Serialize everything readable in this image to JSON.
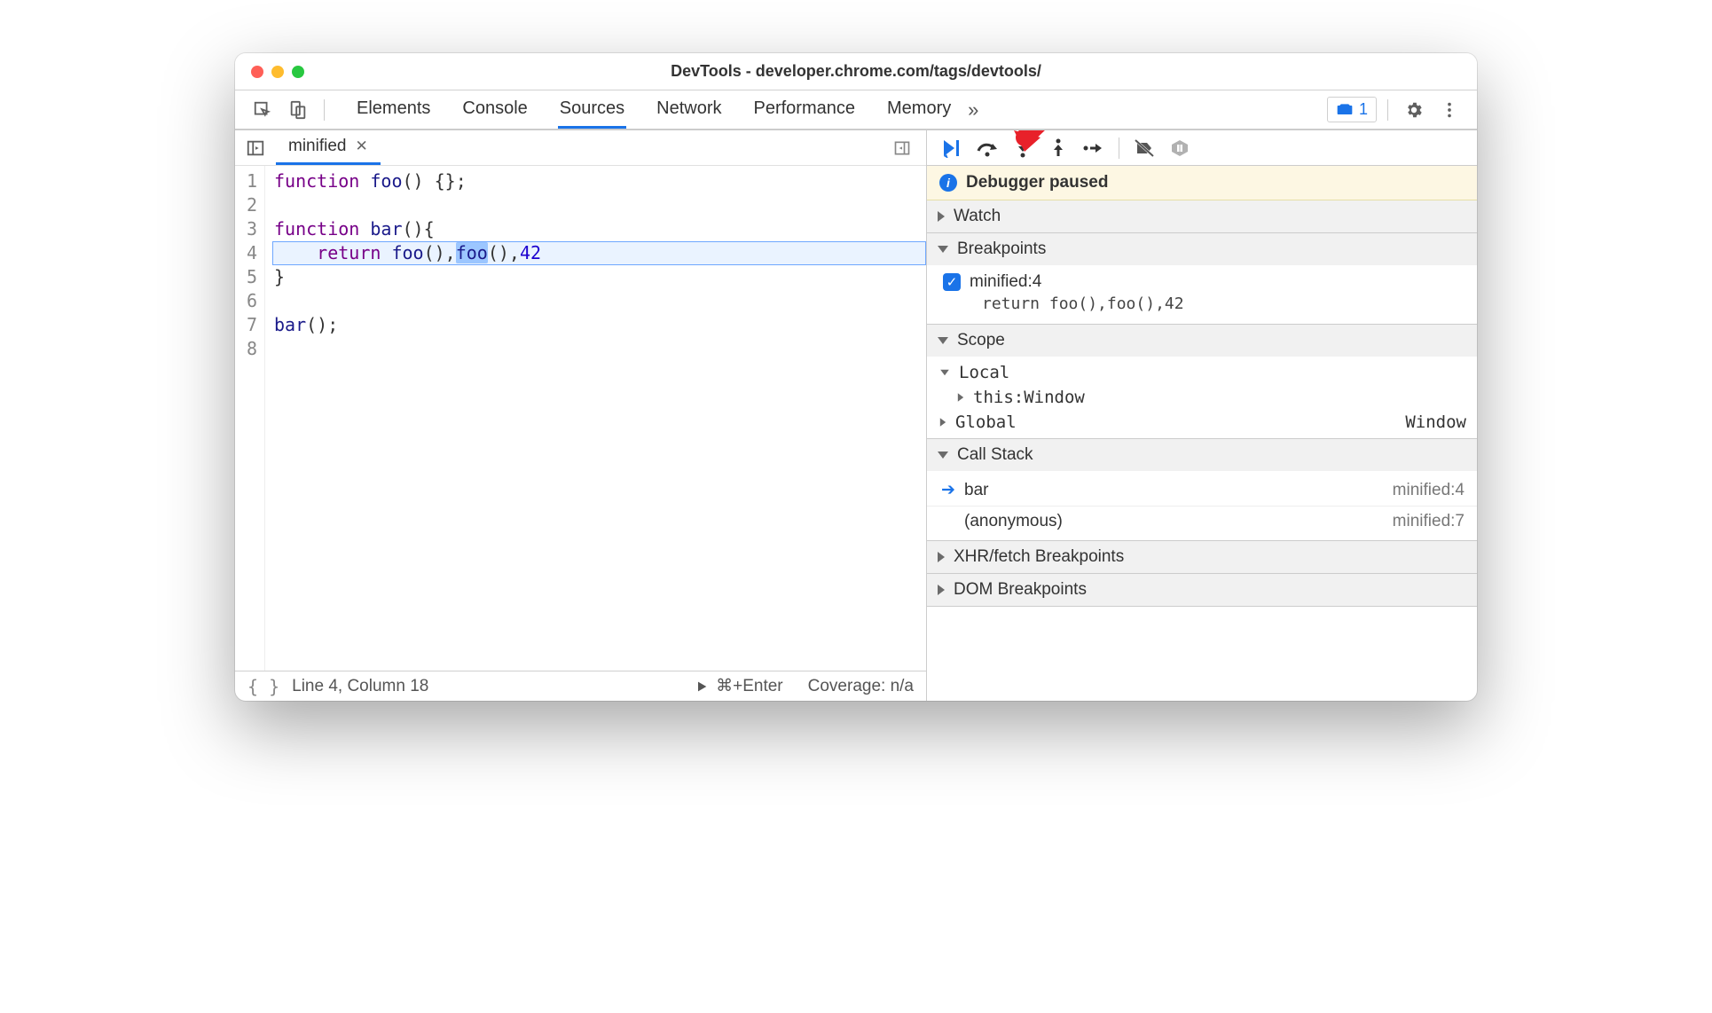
{
  "window": {
    "title": "DevTools - developer.chrome.com/tags/devtools/"
  },
  "tabs": {
    "items": [
      "Elements",
      "Console",
      "Sources",
      "Network",
      "Performance",
      "Memory"
    ],
    "active_index": 2,
    "more_glyph": "»"
  },
  "issues": {
    "count": "1"
  },
  "file_tab": {
    "name": "minified"
  },
  "code": {
    "lines": [
      {
        "n": "1",
        "html": "<span class='kw'>function</span> <span class='fn'>foo</span>() {};"
      },
      {
        "n": "2",
        "html": ""
      },
      {
        "n": "3",
        "html": "<span class='kw'>function</span> <span class='fn'>bar</span>(){"
      },
      {
        "n": "4",
        "hl": true,
        "html": "    <span class='kw'>return</span> <span class='fn'>foo</span>(),<span class='sel'><span class='fn'>foo</span></span>(),<span class='num'>42</span>"
      },
      {
        "n": "5",
        "html": "}"
      },
      {
        "n": "6",
        "html": ""
      },
      {
        "n": "7",
        "html": "<span class='fn'>bar</span>();"
      },
      {
        "n": "8",
        "html": ""
      }
    ]
  },
  "status": {
    "position": "Line 4, Column 18",
    "run_hint": "⌘+Enter",
    "coverage": "Coverage: n/a"
  },
  "debugger": {
    "paused_label": "Debugger paused",
    "sections": {
      "watch": "Watch",
      "breakpoints": "Breakpoints",
      "scope": "Scope",
      "callstack": "Call Stack",
      "xhr": "XHR/fetch Breakpoints",
      "dom": "DOM Breakpoints"
    },
    "breakpoint": {
      "label": "minified:4",
      "code": "return foo(),foo(),42"
    },
    "scope": {
      "local_label": "Local",
      "this_key": "this",
      "this_val": "Window",
      "global_label": "Global",
      "global_val": "Window"
    },
    "callstack": [
      {
        "fn": "bar",
        "loc": "minified:4",
        "current": true
      },
      {
        "fn": "(anonymous)",
        "loc": "minified:7",
        "current": false
      }
    ]
  }
}
